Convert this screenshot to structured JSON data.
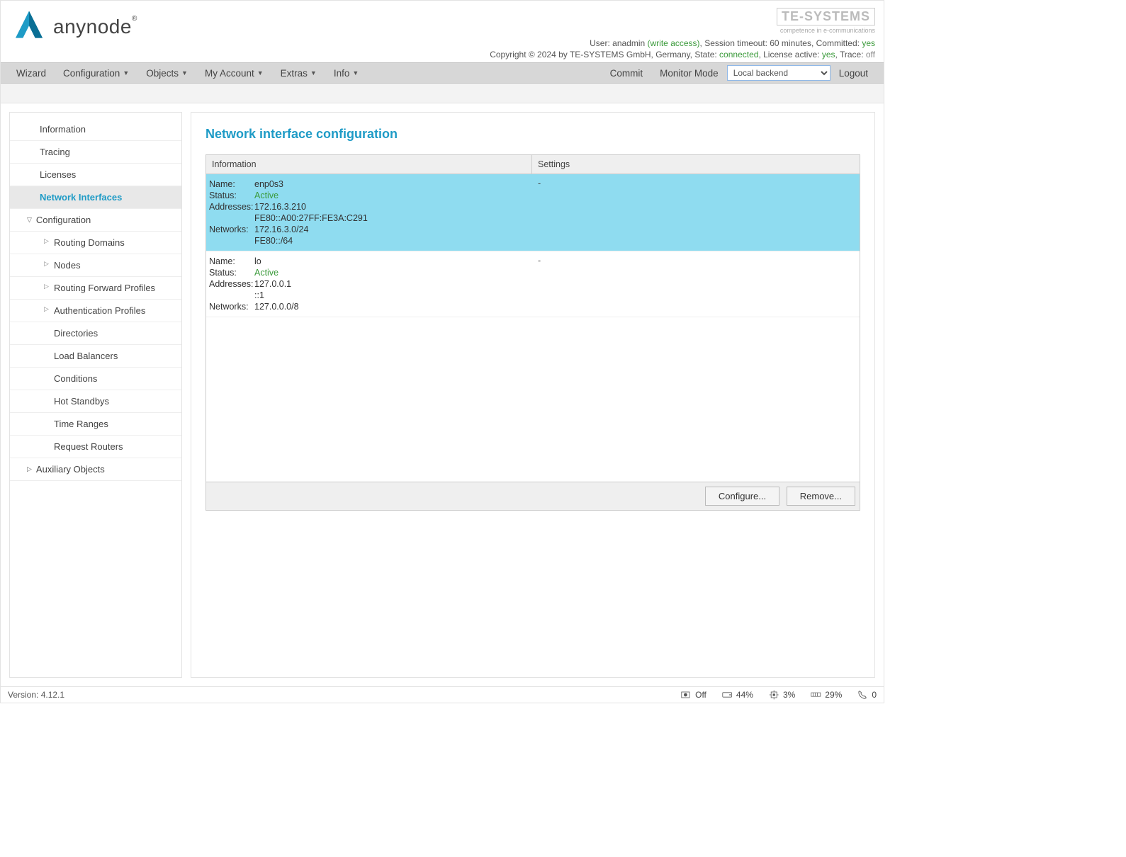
{
  "header": {
    "brand": "anynode",
    "te_logo": "TE-SYSTEMS",
    "te_sub": "competence in e-communications",
    "user_label": "User: ",
    "user_name": "anadmin",
    "access": " (write access)",
    "session_label": ", Session timeout: ",
    "session_val": "60 minutes",
    "committed_label": ", Committed: ",
    "committed_val": "yes",
    "copyright": "Copyright © 2024 by TE-SYSTEMS GmbH, Germany, State: ",
    "state_val": "connected",
    "license_label": ", License active: ",
    "license_val": "yes",
    "trace_label": ", Trace: ",
    "trace_val": "off"
  },
  "menubar": {
    "wizard": "Wizard",
    "configuration": "Configuration",
    "objects": "Objects",
    "my_account": "My Account",
    "extras": "Extras",
    "info": "Info",
    "commit": "Commit",
    "monitor": "Monitor Mode",
    "backend": "Local backend",
    "logout": "Logout"
  },
  "sidebar": {
    "information": "Information",
    "tracing": "Tracing",
    "licenses": "Licenses",
    "network_interfaces": "Network Interfaces",
    "configuration": "Configuration",
    "routing_domains": "Routing Domains",
    "nodes": "Nodes",
    "routing_forward": "Routing Forward Profiles",
    "auth_profiles": "Authentication Profiles",
    "directories": "Directories",
    "load_balancers": "Load Balancers",
    "conditions": "Conditions",
    "hot_standbys": "Hot Standbys",
    "time_ranges": "Time Ranges",
    "request_routers": "Request Routers",
    "auxiliary": "Auxiliary Objects"
  },
  "content": {
    "title": "Network interface configuration",
    "col_info": "Information",
    "col_settings": "Settings",
    "rows": [
      {
        "name_k": "Name:",
        "name_v": "enp0s3",
        "status_k": "Status:",
        "status_v": "Active",
        "addr_k": "Addresses:",
        "addr_v1": "172.16.3.210",
        "addr_v2": "FE80::A00:27FF:FE3A:C291",
        "net_k": "Networks:",
        "net_v1": "172.16.3.0/24",
        "net_v2": "FE80::/64",
        "settings": "-"
      },
      {
        "name_k": "Name:",
        "name_v": "lo",
        "status_k": "Status:",
        "status_v": "Active",
        "addr_k": "Addresses:",
        "addr_v1": "127.0.0.1",
        "addr_v2": "::1",
        "net_k": "Networks:",
        "net_v1": "127.0.0.0/8",
        "net_v2": "",
        "settings": "-"
      }
    ],
    "configure_btn": "Configure...",
    "remove_btn": "Remove..."
  },
  "footer": {
    "version_label": "Version: ",
    "version_val": "4.12.1",
    "rec": "Off",
    "disk": "44%",
    "cpu": "3%",
    "mem": "29%",
    "calls": "0"
  }
}
